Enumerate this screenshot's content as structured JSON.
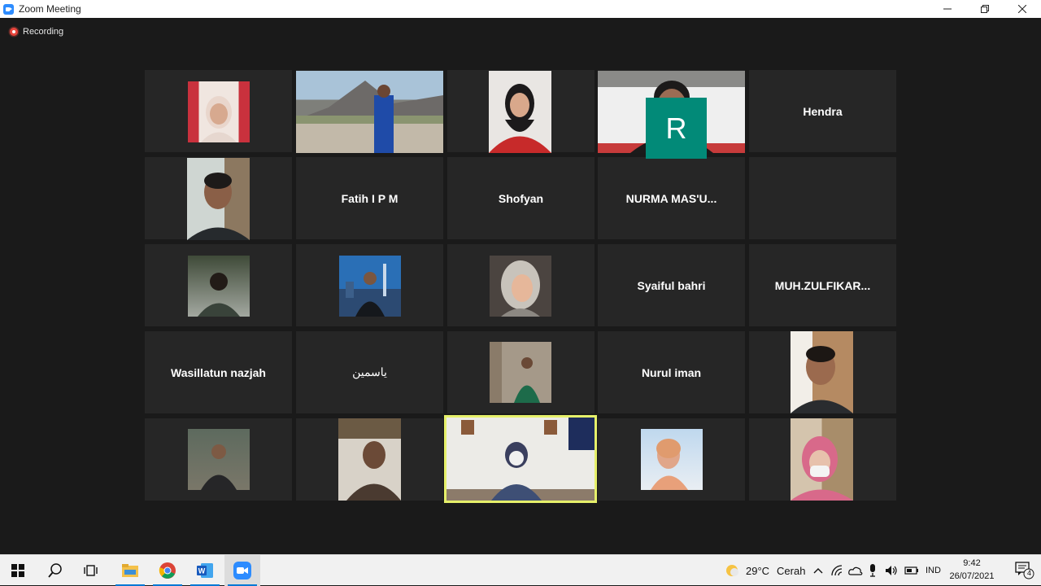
{
  "window": {
    "title": "Zoom Meeting",
    "controls": [
      "minimize",
      "restore",
      "close"
    ]
  },
  "recording": {
    "label": "Recording"
  },
  "participants": [
    {
      "type": "video",
      "name": ""
    },
    {
      "type": "video",
      "name": ""
    },
    {
      "type": "video",
      "name": ""
    },
    {
      "type": "video",
      "name": ""
    },
    {
      "type": "name",
      "name": "Hendra"
    },
    {
      "type": "video",
      "name": ""
    },
    {
      "type": "name",
      "name": "Fatih I P M"
    },
    {
      "type": "name",
      "name": "Shofyan"
    },
    {
      "type": "name",
      "name": "NURMA  MAS'U..."
    },
    {
      "type": "avatar",
      "name": "",
      "letter": "R",
      "color": "#028a78"
    },
    {
      "type": "video",
      "name": ""
    },
    {
      "type": "video",
      "name": ""
    },
    {
      "type": "video",
      "name": ""
    },
    {
      "type": "name",
      "name": "Syaiful bahri"
    },
    {
      "type": "name",
      "name": "MUH.ZULFIKAR..."
    },
    {
      "type": "name",
      "name": "Wasillatun nazjah"
    },
    {
      "type": "name",
      "name": "ياسمين"
    },
    {
      "type": "video",
      "name": ""
    },
    {
      "type": "name",
      "name": "Nurul iman"
    },
    {
      "type": "video",
      "name": ""
    },
    {
      "type": "video",
      "name": ""
    },
    {
      "type": "video",
      "name": ""
    },
    {
      "type": "video",
      "name": "",
      "active_speaker": true
    },
    {
      "type": "video",
      "name": ""
    },
    {
      "type": "video",
      "name": ""
    }
  ],
  "taskbar": {
    "apps": [
      "start-icon",
      "search-icon",
      "task-view-icon",
      "file-explorer-icon",
      "chrome-icon",
      "word-icon",
      "zoom-icon"
    ],
    "weather": {
      "temp": "29°C",
      "condition": "Cerah"
    },
    "language": "IND",
    "time": "9:42",
    "date": "26/07/2021",
    "notification_count": "4"
  },
  "colors": {
    "accent": "#2d8cff",
    "active_speaker_border": "#e6f06a",
    "recording": "#e8453c"
  }
}
